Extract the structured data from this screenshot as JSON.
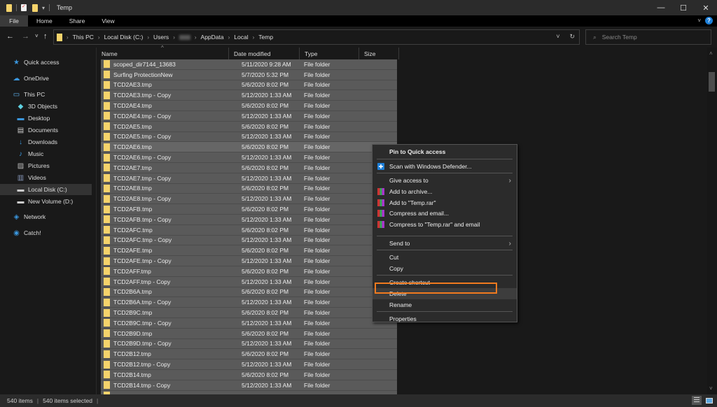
{
  "titlebar": {
    "title": "Temp",
    "controls": {
      "minimize": "—",
      "maximize": "☐",
      "close": "✕"
    }
  },
  "ribbon": {
    "tabs": [
      "File",
      "Home",
      "Share",
      "View"
    ],
    "help": "?"
  },
  "navigation": {
    "back": "←",
    "forward": "→",
    "recent": "˅",
    "up": "↑",
    "breadcrumb": [
      "This PC",
      "Local Disk (C:)",
      "Users",
      "",
      "AppData",
      "Local",
      "Temp"
    ],
    "refresh": "↻",
    "search_placeholder": "Search Temp"
  },
  "sidebar": {
    "items": [
      {
        "label": "Quick access",
        "icon": "star-icon",
        "glyph": "★",
        "color": "#3a96dd"
      },
      {
        "label": "OneDrive",
        "icon": "cloud-icon",
        "glyph": "☁",
        "color": "#3a96dd"
      },
      {
        "label": "This PC",
        "icon": "computer-icon",
        "glyph": "▭",
        "color": "#5fb4f0"
      },
      {
        "label": "3D Objects",
        "icon": "cube-icon",
        "glyph": "◆",
        "color": "#5fd0e0"
      },
      {
        "label": "Desktop",
        "icon": "desktop-icon",
        "glyph": "▬",
        "color": "#3a96dd"
      },
      {
        "label": "Documents",
        "icon": "document-icon",
        "glyph": "▤",
        "color": "#cccccc"
      },
      {
        "label": "Downloads",
        "icon": "download-icon",
        "glyph": "↓",
        "color": "#3a96dd"
      },
      {
        "label": "Music",
        "icon": "music-icon",
        "glyph": "♪",
        "color": "#3a96dd"
      },
      {
        "label": "Pictures",
        "icon": "pictures-icon",
        "glyph": "▨",
        "color": "#bbbbbb"
      },
      {
        "label": "Videos",
        "icon": "videos-icon",
        "glyph": "▥",
        "color": "#8899bb"
      },
      {
        "label": "Local Disk (C:)",
        "icon": "drive-icon",
        "glyph": "▬",
        "color": "#cccccc",
        "selected": true
      },
      {
        "label": "New Volume (D:)",
        "icon": "drive-icon",
        "glyph": "▬",
        "color": "#cccccc"
      },
      {
        "label": "Network",
        "icon": "network-icon",
        "glyph": "◈",
        "color": "#3a96dd"
      },
      {
        "label": "Catch!",
        "icon": "catch-icon",
        "glyph": "◉",
        "color": "#3a96dd"
      }
    ]
  },
  "columns": [
    "Name",
    "Date modified",
    "Type",
    "Size"
  ],
  "files": [
    {
      "name": "scoped_dir7144_13683",
      "date": "5/11/2020 9:28 AM",
      "type": "File folder"
    },
    {
      "name": "Surfing ProtectionNew",
      "date": "5/7/2020 5:32 PM",
      "type": "File folder"
    },
    {
      "name": "TCD2AE3.tmp",
      "date": "5/6/2020 8:02 PM",
      "type": "File folder"
    },
    {
      "name": "TCD2AE3.tmp - Copy",
      "date": "5/12/2020 1:33 AM",
      "type": "File folder"
    },
    {
      "name": "TCD2AE4.tmp",
      "date": "5/6/2020 8:02 PM",
      "type": "File folder"
    },
    {
      "name": "TCD2AE4.tmp - Copy",
      "date": "5/12/2020 1:33 AM",
      "type": "File folder"
    },
    {
      "name": "TCD2AE5.tmp",
      "date": "5/6/2020 8:02 PM",
      "type": "File folder"
    },
    {
      "name": "TCD2AE5.tmp - Copy",
      "date": "5/12/2020 1:33 AM",
      "type": "File folder"
    },
    {
      "name": "TCD2AE6.tmp",
      "date": "5/6/2020 8:02 PM",
      "type": "File folder",
      "focus": true
    },
    {
      "name": "TCD2AE6.tmp - Copy",
      "date": "5/12/2020 1:33 AM",
      "type": "File folder"
    },
    {
      "name": "TCD2AE7.tmp",
      "date": "5/6/2020 8:02 PM",
      "type": "File folder"
    },
    {
      "name": "TCD2AE7.tmp - Copy",
      "date": "5/12/2020 1:33 AM",
      "type": "File folder"
    },
    {
      "name": "TCD2AE8.tmp",
      "date": "5/6/2020 8:02 PM",
      "type": "File folder"
    },
    {
      "name": "TCD2AE8.tmp - Copy",
      "date": "5/12/2020 1:33 AM",
      "type": "File folder"
    },
    {
      "name": "TCD2AFB.tmp",
      "date": "5/6/2020 8:02 PM",
      "type": "File folder"
    },
    {
      "name": "TCD2AFB.tmp - Copy",
      "date": "5/12/2020 1:33 AM",
      "type": "File folder"
    },
    {
      "name": "TCD2AFC.tmp",
      "date": "5/6/2020 8:02 PM",
      "type": "File folder"
    },
    {
      "name": "TCD2AFC.tmp - Copy",
      "date": "5/12/2020 1:33 AM",
      "type": "File folder"
    },
    {
      "name": "TCD2AFE.tmp",
      "date": "5/6/2020 8:02 PM",
      "type": "File folder"
    },
    {
      "name": "TCD2AFE.tmp - Copy",
      "date": "5/12/2020 1:33 AM",
      "type": "File folder"
    },
    {
      "name": "TCD2AFF.tmp",
      "date": "5/6/2020 8:02 PM",
      "type": "File folder"
    },
    {
      "name": "TCD2AFF.tmp - Copy",
      "date": "5/12/2020 1:33 AM",
      "type": "File folder"
    },
    {
      "name": "TCD2B6A.tmp",
      "date": "5/6/2020 8:02 PM",
      "type": "File folder"
    },
    {
      "name": "TCD2B6A.tmp - Copy",
      "date": "5/12/2020 1:33 AM",
      "type": "File folder"
    },
    {
      "name": "TCD2B9C.tmp",
      "date": "5/6/2020 8:02 PM",
      "type": "File folder"
    },
    {
      "name": "TCD2B9C.tmp - Copy",
      "date": "5/12/2020 1:33 AM",
      "type": "File folder"
    },
    {
      "name": "TCD2B9D.tmp",
      "date": "5/6/2020 8:02 PM",
      "type": "File folder"
    },
    {
      "name": "TCD2B9D.tmp - Copy",
      "date": "5/12/2020 1:33 AM",
      "type": "File folder"
    },
    {
      "name": "TCD2B12.tmp",
      "date": "5/6/2020 8:02 PM",
      "type": "File folder"
    },
    {
      "name": "TCD2B12.tmp - Copy",
      "date": "5/12/2020 1:33 AM",
      "type": "File folder"
    },
    {
      "name": "TCD2B14.tmp",
      "date": "5/6/2020 8:02 PM",
      "type": "File folder"
    },
    {
      "name": "TCD2B14.tmp - Copy",
      "date": "5/12/2020 1:33 AM",
      "type": "File folder"
    },
    {
      "name": "",
      "date": "",
      "type": ""
    }
  ],
  "context_menu": {
    "items": [
      {
        "label": "Pin to Quick access",
        "bold": true
      },
      {
        "sep": true
      },
      {
        "label": "Scan with Windows Defender...",
        "icon": "defender"
      },
      {
        "sep": true
      },
      {
        "label": "Give access to",
        "submenu": true
      },
      {
        "label": "Add to archive...",
        "icon": "rar"
      },
      {
        "label": "Add to \"Temp.rar\"",
        "icon": "rar"
      },
      {
        "label": "Compress and email...",
        "icon": "rar"
      },
      {
        "label": "Compress to \"Temp.rar\" and email",
        "icon": "rar"
      },
      {
        "sep": true
      },
      {
        "label": "Send to",
        "submenu": true
      },
      {
        "sep": true
      },
      {
        "label": "Cut"
      },
      {
        "label": "Copy"
      },
      {
        "sep": true
      },
      {
        "label": "Create shortcut"
      },
      {
        "label": "Delete",
        "highlighted": true
      },
      {
        "label": "Rename"
      },
      {
        "sep": true
      },
      {
        "label": "Properties"
      }
    ],
    "highlight_color": "#f07a1f"
  },
  "status": {
    "item_count": "540 items",
    "selected_count": "540 items selected"
  }
}
